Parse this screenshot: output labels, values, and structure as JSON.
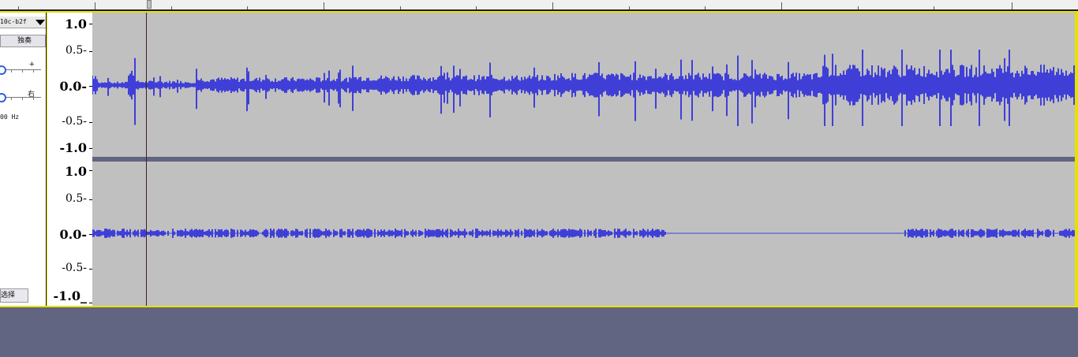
{
  "track": {
    "name": "10c-b2f",
    "solo_label": "独奏",
    "gain_label": "+",
    "pan_label": "右",
    "sample_rate_label": "00 Hz",
    "select_label": "选择"
  },
  "channel_top": {
    "ruler": {
      "v1": "1.0",
      "v2": "0.5-",
      "v3": "0.0-",
      "v4": "-0.5-",
      "v5": "-1.0"
    }
  },
  "channel_bottom": {
    "ruler": {
      "v1": "1.0",
      "v2": "0.5-",
      "v3": "0.0-",
      "v4": "-0.5-",
      "v5": "-1.0_"
    }
  },
  "colors": {
    "waveform": "#3f3fd8",
    "waveform_dark": "#2f2fbf",
    "track_background": "#c0c0c0",
    "selected_frame": "#e6e200",
    "workspace": "#626581"
  }
}
